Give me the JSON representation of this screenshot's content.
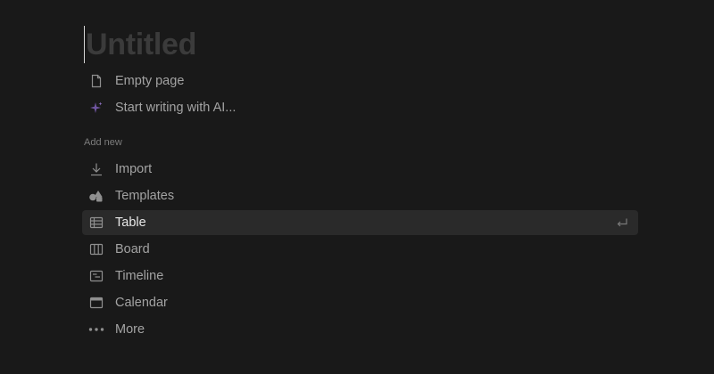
{
  "page": {
    "title_placeholder": "Untitled"
  },
  "quick_actions": [
    {
      "label": "Empty page",
      "icon": "document-icon"
    },
    {
      "label": "Start writing with AI...",
      "icon": "ai-sparkle-icon"
    }
  ],
  "add_new": {
    "heading": "Add new",
    "items": [
      {
        "label": "Import",
        "icon": "import-icon"
      },
      {
        "label": "Templates",
        "icon": "templates-icon"
      },
      {
        "label": "Table",
        "icon": "table-icon",
        "selected": true
      },
      {
        "label": "Board",
        "icon": "board-icon"
      },
      {
        "label": "Timeline",
        "icon": "timeline-icon"
      },
      {
        "label": "Calendar",
        "icon": "calendar-icon"
      },
      {
        "label": "More",
        "icon": "more-dots-icon"
      }
    ]
  },
  "colors": {
    "background": "#191919",
    "selected_row": "#2a2a2a",
    "ai_accent": "#7b5ea7"
  }
}
